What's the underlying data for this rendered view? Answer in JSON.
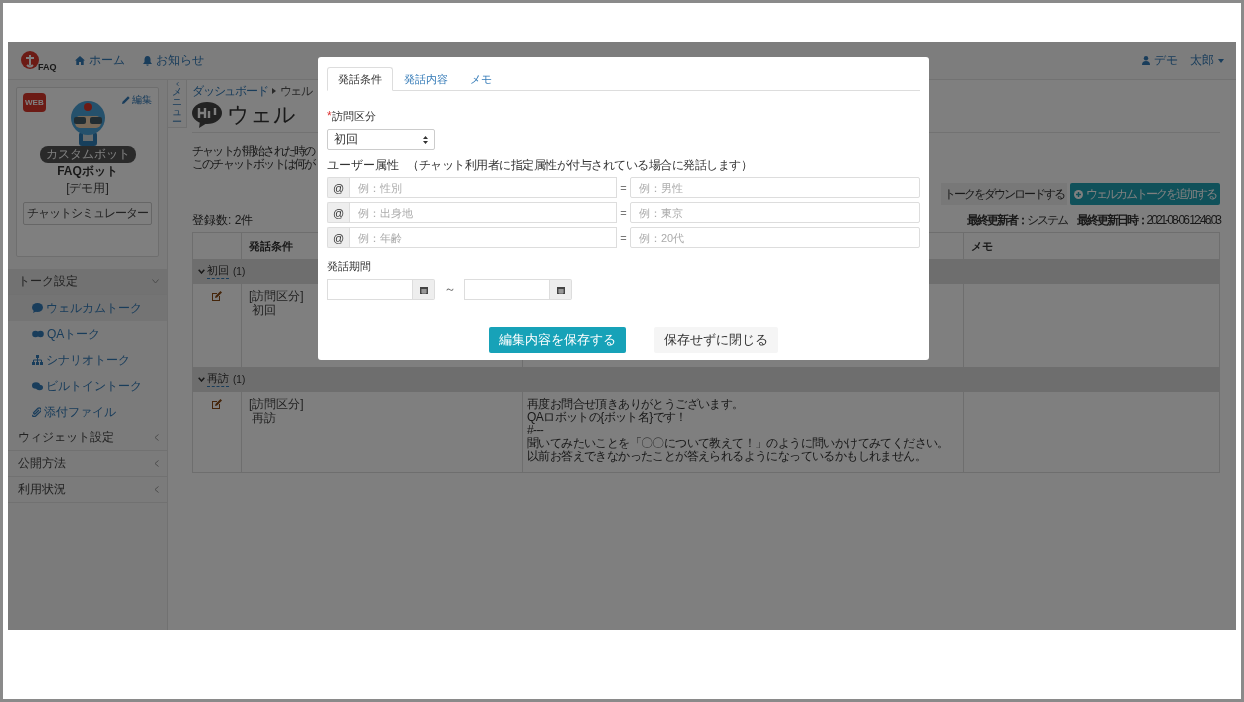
{
  "navbar": {
    "logo_text": "FAQ",
    "links": [
      {
        "kind": "home",
        "label": "ホーム"
      },
      {
        "kind": "bell",
        "label": "お知らせ"
      }
    ],
    "user": "デモ　太郎"
  },
  "sidebar": {
    "profile": {
      "channel": "WEB",
      "edit": "編集",
      "badge": "カスタムボット",
      "name": "FAQボット",
      "note": "[デモ用]",
      "simulator": "チャットシミュレーター"
    },
    "menu": [
      {
        "label": "トーク設定",
        "expanded": true,
        "children": [
          {
            "kind": "hi",
            "label": "ウェルカムトーク",
            "selected": true
          },
          {
            "kind": "qa",
            "label": "QAトーク",
            "selected": false
          },
          {
            "kind": "tree",
            "label": "シナリオトーク",
            "selected": false
          },
          {
            "kind": "chat",
            "label": "ビルトイントーク",
            "selected": false
          },
          {
            "kind": "clip",
            "label": "添付ファイル",
            "selected": false
          }
        ]
      },
      {
        "label": "ウィジェット設定",
        "expanded": false
      },
      {
        "label": "公開方法",
        "expanded": false
      },
      {
        "label": "利用状況",
        "expanded": false
      }
    ]
  },
  "menu_toggle": "メニュー",
  "breadcrumb": [
    "ダッシュボード",
    "ウェル"
  ],
  "page_title": "ウェル",
  "description": [
    "チャットが開始された時の",
    "このチャットボットは何が"
  ],
  "download_button": "トークをダウンロードする",
  "add_button": "ウェルカムトークを追加する",
  "count": "登録数: 2件",
  "updated": "**最終更新者：**システム　**最終更新日時：**2021-08-06 12:46:03",
  "table": {
    "columns": [
      "発話条件",
      "メモ"
    ],
    "groups": [
      {
        "label": "初回",
        "count": "(1)",
        "expanded": true,
        "rows": [
          {
            "condition_label": "[訪問区分]",
            "condition": "初回",
            "content": []
          }
        ]
      },
      {
        "label": "再訪",
        "count": "(1)",
        "expanded": true,
        "rows": [
          {
            "condition_label": "[訪問区分]",
            "condition": "再訪",
            "content": [
              "再度お問合せ頂きありがとうございます。",
              "QAロボットの{ボット名}です！",
              "#---",
              "聞いてみたいことを「〇〇について教えて！」のように問いかけてみてください。",
              "以前お答えできなかったことが答えられるようになっているかもしれません。"
            ]
          }
        ]
      }
    ]
  },
  "modal": {
    "tabs": [
      {
        "label": "発話条件",
        "selected": true
      },
      {
        "label": "発話内容",
        "selected": false
      },
      {
        "label": "メモ",
        "selected": false
      }
    ],
    "visit_type": {
      "required_mark": "*",
      "label": "訪問区分",
      "value": "初回"
    },
    "attributes": {
      "label": "ユーザー属性",
      "note": "（チャット利用者に指定属性が付与されている場合に発話します）",
      "rows": [
        {
          "prefix": "@",
          "key_placeholder": "例：性別",
          "separator": "=",
          "value_placeholder": "例：男性"
        },
        {
          "prefix": "@",
          "key_placeholder": "例：出身地",
          "separator": "=",
          "value_placeholder": "例：東京"
        },
        {
          "prefix": "@",
          "key_placeholder": "例：年齢",
          "separator": "=",
          "value_placeholder": "例：20代"
        }
      ]
    },
    "period": {
      "label": "発話期間",
      "separator": "～"
    },
    "buttons": [
      {
        "kind": "primary",
        "label": "編集内容を保存する"
      },
      {
        "kind": "secondary",
        "label": "保存せずに閉じる"
      }
    ]
  }
}
